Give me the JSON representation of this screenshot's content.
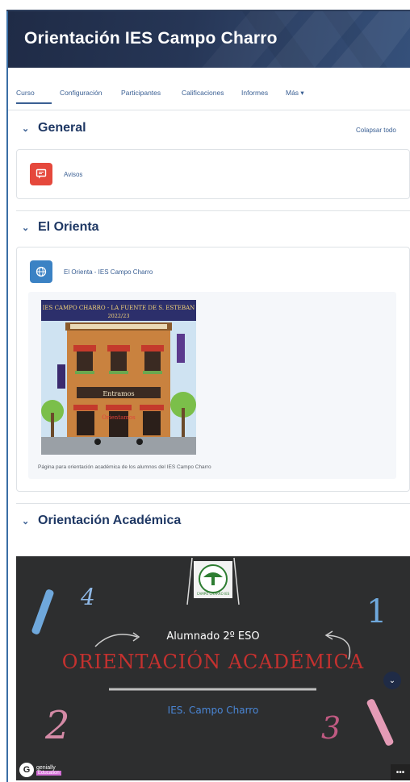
{
  "header": {
    "title": "Orientación IES Campo Charro"
  },
  "nav": {
    "tabs": [
      {
        "label": "Curso"
      },
      {
        "label": "Configuración"
      },
      {
        "label": "Participantes"
      },
      {
        "label": "Calificaciones"
      },
      {
        "label": "Informes"
      },
      {
        "label": "Más ▾"
      }
    ]
  },
  "sections": {
    "general": {
      "title": "General",
      "collapse_all": "Colapsar todo",
      "activity": {
        "label": "Avisos",
        "icon": "forum-icon",
        "color": "#e5483c"
      }
    },
    "orienta": {
      "title": "El Orienta",
      "activity": {
        "label": "El Orienta - IES Campo Charro",
        "icon": "globe-icon",
        "color": "#3b82c4"
      },
      "image": {
        "banner_text": "IES CAMPO CHARRO - LA FUENTE DE S. ESTEBAN",
        "year": "2022/23",
        "sign": "Entramos",
        "door_text": "Orientamos"
      },
      "caption": "Página para orientación académica de los alumnos del IES Campo Charro"
    },
    "academica": {
      "title": "Orientación Académica",
      "embed": {
        "subtitle": "Alumnado 2º ESO",
        "title": "ORIENTACIÓN ACADÉMICA",
        "school": "IES. Campo Charro",
        "brand": "genially",
        "brand_tag": "Education",
        "logo_text": "CAMPO CHARRO IES"
      }
    }
  }
}
